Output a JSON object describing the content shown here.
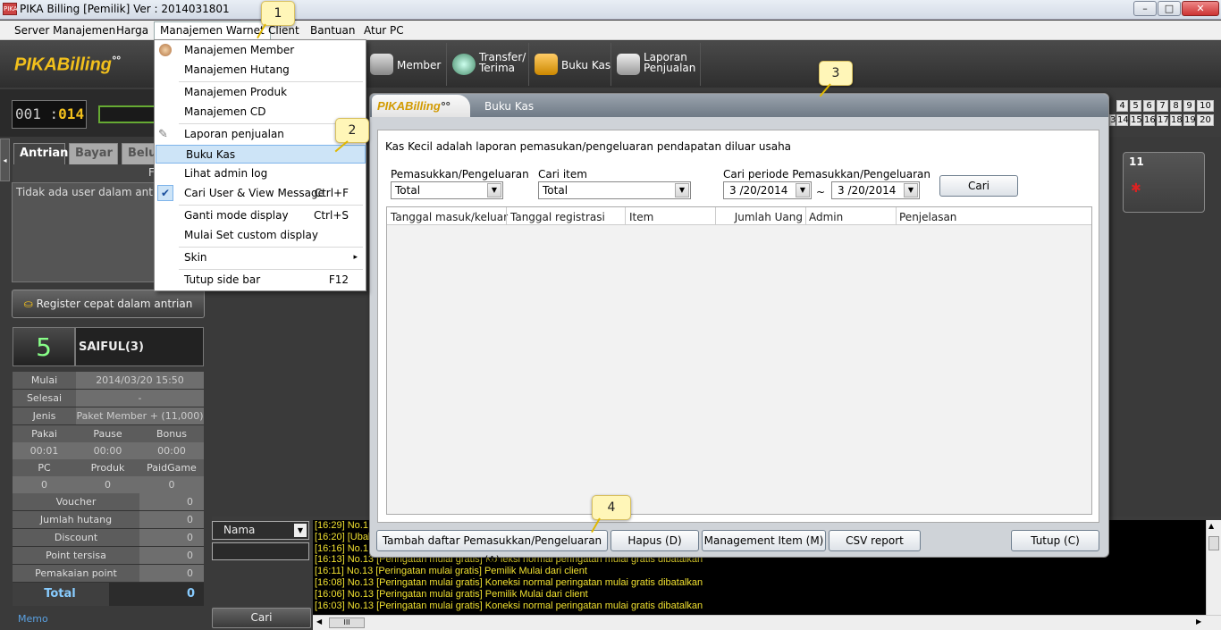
{
  "window": {
    "title": "PIKA Billing [Pemilik]  Ver : 2014031801",
    "app_icon": "PIKA"
  },
  "menubar": {
    "items": [
      "Server Manajemen",
      "Harga",
      "Manajemen Warnet",
      "Client",
      "Bantuan",
      "Atur PC"
    ]
  },
  "logo": {
    "text": "PIKABilling"
  },
  "toolbar": {
    "buttons": [
      "Member",
      "Transfer/",
      "Terima",
      "Buku Kas",
      "Laporan",
      "Penjualan"
    ]
  },
  "counter": {
    "left": "001 :",
    "right": "014"
  },
  "left_tabs": [
    "Antrian",
    "Bayar",
    "Belu"
  ],
  "left_tab_hint": "F",
  "queue": {
    "empty_message": "Tidak ada user dalam antrian"
  },
  "register_button": "Register cepat dalam antrian",
  "session": {
    "pc_number": "5",
    "user": "SAIFUL(3)",
    "mulai_label": "Mulai",
    "mulai_value": "2014/03/20 15:50",
    "selesai_label": "Selesai",
    "selesai_value": "-",
    "jenis_label": "Jenis",
    "jenis_value": "Paket Member + (11,000)",
    "cols1": [
      "Pakai",
      "Pause",
      "Bonus"
    ],
    "vals1": [
      "00:01",
      "00:00",
      "00:00"
    ],
    "cols2": [
      "PC",
      "Produk",
      "PaidGame"
    ],
    "vals2": [
      "0",
      "0",
      "0"
    ],
    "rows": [
      {
        "label": "Voucher",
        "value": "0"
      },
      {
        "label": "Jumlah hutang",
        "value": "0"
      },
      {
        "label": "Discount",
        "value": "0"
      },
      {
        "label": "Point tersisa",
        "value": "0"
      },
      {
        "label": "Pemakaian point",
        "value": "0"
      }
    ],
    "total_label": "Total",
    "total_value": "0"
  },
  "memo": "Memo",
  "pc_grid": [
    "4",
    "5",
    "6",
    "7",
    "8",
    "9",
    "10",
    "3",
    "14",
    "15",
    "16",
    "17",
    "18",
    "19",
    "20"
  ],
  "pc_tile": {
    "number": "11"
  },
  "search_bottom": {
    "select": "Nama",
    "button": "Cari"
  },
  "log_lines": [
    "[16:29] No.1",
    "[16:20] [Ubal",
    "[16:16] No.1",
    "[16:13] No.13 [Peringatan mulai gratis] Koneksi normal peringatan mulai gratis dibatalkan",
    "[16:11] No.13 [Peringatan mulai gratis] Pemilik Mulai dari client",
    "[16:08] No.13 [Peringatan mulai gratis] Koneksi normal peringatan mulai gratis dibatalkan",
    "[16:06] No.13 [Peringatan mulai gratis] Pemilik Mulai dari client",
    "[16:03] No.13 [Peringatan mulai gratis] Koneksi normal peringatan mulai gratis dibatalkan"
  ],
  "scroll_thumb": "III",
  "dropdown": {
    "items": [
      {
        "label": "Manajemen Member",
        "shortcut": ""
      },
      {
        "label": "Manajemen Hutang",
        "shortcut": ""
      },
      {
        "label": "Manajemen Produk",
        "shortcut": ""
      },
      {
        "label": "Manajemen CD",
        "shortcut": ""
      },
      {
        "label": "Laporan penjualan",
        "shortcut": ""
      },
      {
        "label": "Buku Kas",
        "shortcut": ""
      },
      {
        "label": "Lihat admin log",
        "shortcut": ""
      },
      {
        "label": "Cari User & View Message",
        "shortcut": "Ctrl+F"
      },
      {
        "label": "Ganti mode display",
        "shortcut": "Ctrl+S"
      },
      {
        "label": "Mulai Set custom display",
        "shortcut": ""
      },
      {
        "label": "Skin",
        "shortcut": "▸"
      },
      {
        "label": "Tutup side bar",
        "shortcut": "F12"
      }
    ]
  },
  "dialog": {
    "logo": "PIKABilling",
    "title": "Buku Kas",
    "description": "Kas Kecil adalah laporan pemasukan/pengeluaran pendapatan diluar usaha",
    "filter1_label": "Pemasukkan/Pengeluaran",
    "filter1_value": "Total",
    "filter2_label": "Cari item",
    "filter2_value": "Total",
    "period_label": "Cari periode Pemasukkan/Pengeluaran",
    "date_from": "3 /20/2014",
    "date_to": "3 /20/2014",
    "tilde": "~",
    "search_button": "Cari",
    "columns": [
      "Tanggal masuk/keluar",
      "Tanggal registrasi",
      "Item",
      "Jumlah Uang",
      "Admin",
      "Penjelasan"
    ],
    "buttons": {
      "add": "Tambah daftar Pemasukkan/Pengeluaran (A)",
      "delete": "Hapus (D)",
      "manage": "Management Item (M)",
      "csv": "CSV report",
      "close": "Tutup (C)"
    }
  },
  "callouts": [
    "1",
    "2",
    "3",
    "4"
  ],
  "colors": {
    "accent": "#f2c01c",
    "log_text": "#f0e030",
    "menu_highlight": "#cde4f7",
    "callout": "#fff6b8"
  }
}
